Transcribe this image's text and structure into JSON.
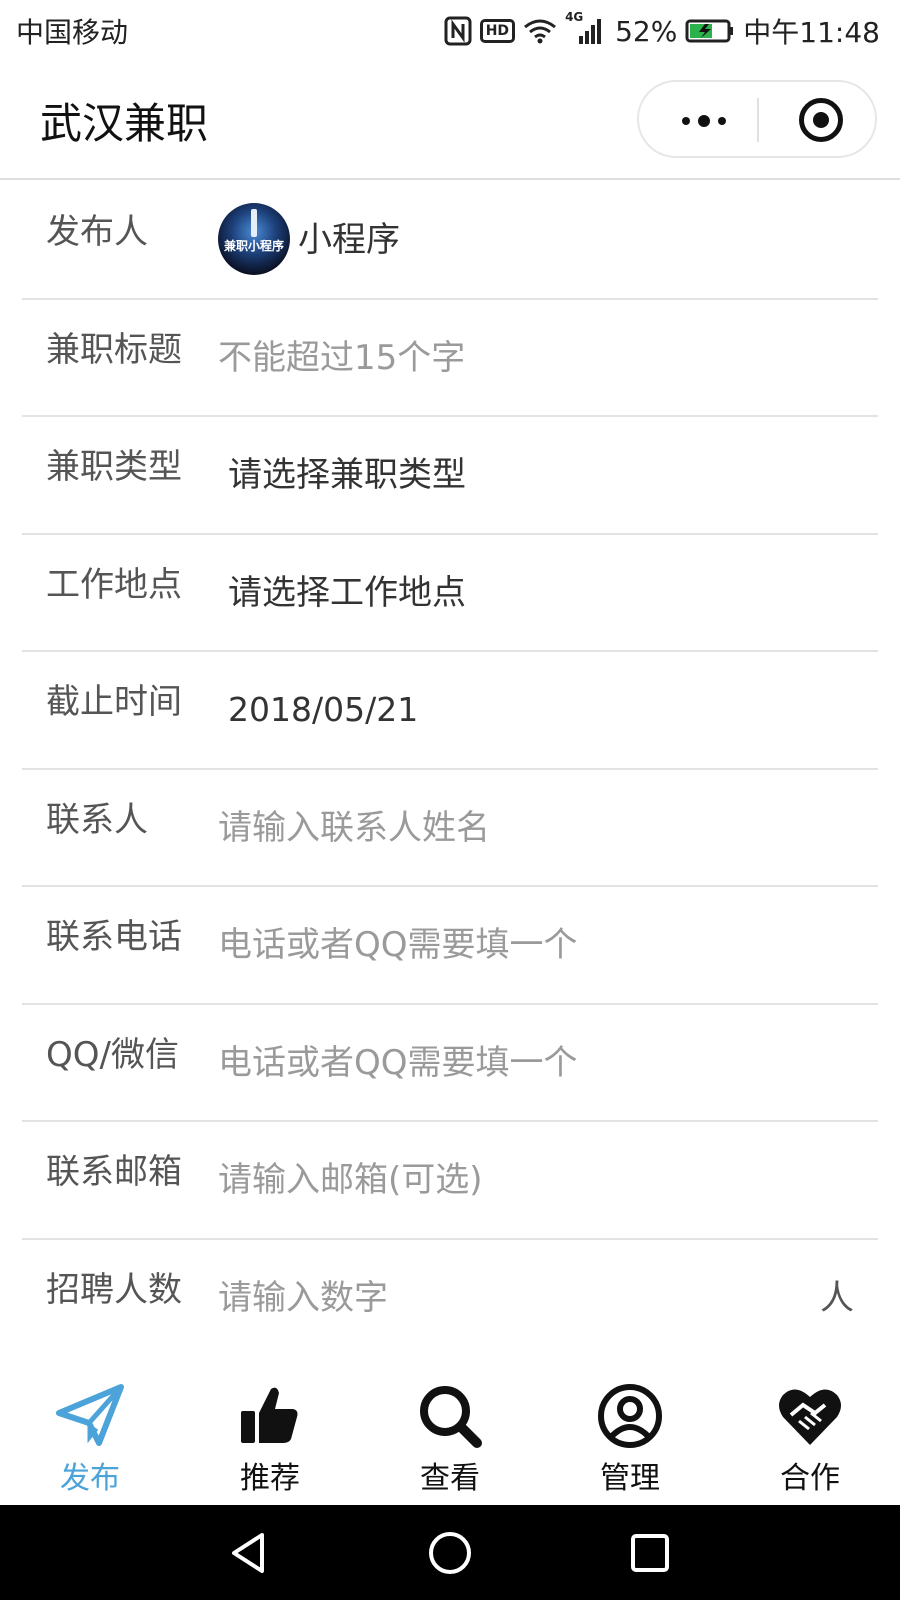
{
  "status_bar": {
    "carrier": "中国移动",
    "network": "4G",
    "battery": "52%",
    "time": "中午11:48"
  },
  "nav": {
    "title": "武汉兼职"
  },
  "form": {
    "publisher": {
      "label": "发布人",
      "name": "小程序",
      "avatar_text": "兼职小程序"
    },
    "rows": [
      {
        "label": "兼职标题",
        "value": "不能超过15个字"
      },
      {
        "label": "兼职类型",
        "value": "请选择兼职类型"
      },
      {
        "label": "工作地点",
        "value": "请选择工作地点"
      },
      {
        "label": "截止时间",
        "value": "2018/05/21"
      },
      {
        "label": "联系人",
        "value": "请输入联系人姓名"
      },
      {
        "label": "联系电话",
        "value": "电话或者QQ需要填一个"
      },
      {
        "label": "QQ/微信",
        "value": "电话或者QQ需要填一个"
      },
      {
        "label": "联系邮箱",
        "value": "请输入邮箱(可选)"
      },
      {
        "label": "招聘人数",
        "value": "请输入数字",
        "unit": "人"
      }
    ]
  },
  "tabs": [
    {
      "label": "发布",
      "icon": "paper-plane-icon",
      "active": true
    },
    {
      "label": "推荐",
      "icon": "thumbs-up-icon",
      "active": false
    },
    {
      "label": "查看",
      "icon": "search-icon",
      "active": false
    },
    {
      "label": "管理",
      "icon": "user-circle-icon",
      "active": false
    },
    {
      "label": "合作",
      "icon": "handshake-heart-icon",
      "active": false
    }
  ],
  "colors": {
    "accent": "#4ca3d9",
    "tab_inactive": "#111111",
    "placeholder": "#9a9a9a",
    "divider": "#e3e3e3"
  }
}
